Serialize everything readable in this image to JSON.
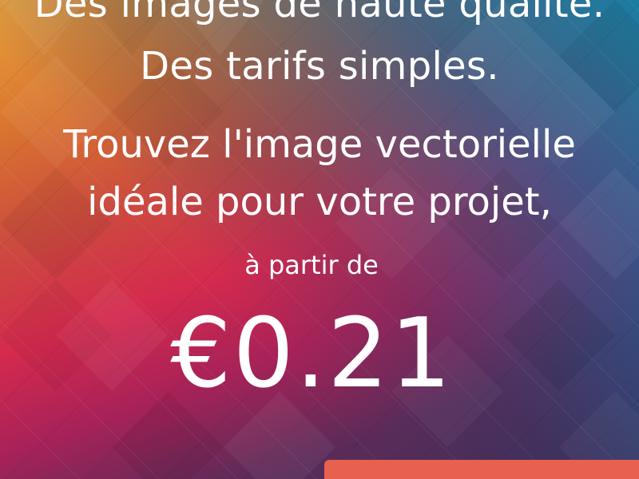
{
  "ad": {
    "headline_line1": "Des images de haute qualité.",
    "headline_line2": "Des tarifs simples.",
    "sub_line1": "Trouvez l'image vectorielle",
    "sub_line2": "idéale pour votre projet,",
    "from_label": "à partir de",
    "price": "€0.21",
    "cta_color": "#e8604e"
  },
  "colors": {
    "orange": "#e9a13b",
    "red": "#d42a4e",
    "magenta": "#a82258",
    "blue": "#1280a8",
    "dark_purple": "#3a2f57"
  }
}
